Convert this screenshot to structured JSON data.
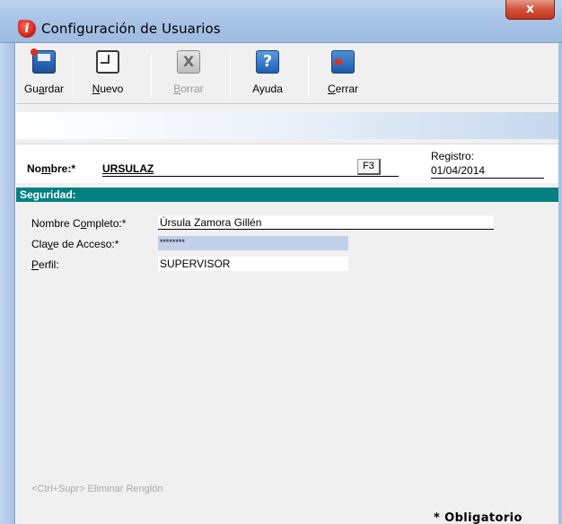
{
  "window": {
    "title": "Configuración de Usuarios",
    "close_glyph": "x",
    "app_icon": "app-i-icon"
  },
  "toolbar": {
    "buttons": [
      {
        "label_pre": "Gu",
        "label_u": "a",
        "label_post": "rdar",
        "icon": "save-icon",
        "enabled": true
      },
      {
        "label_pre": "",
        "label_u": "N",
        "label_post": "uevo",
        "icon": "new-document-icon",
        "enabled": true
      },
      {
        "label_pre": "",
        "label_u": "B",
        "label_post": "orrar",
        "icon": "delete-icon",
        "enabled": false
      },
      {
        "label_pre": "Ayuda",
        "label_u": "",
        "label_post": "",
        "icon": "help-icon",
        "enabled": true
      },
      {
        "label_pre": "",
        "label_u": "C",
        "label_post": "errar",
        "icon": "exit-icon",
        "enabled": true
      }
    ],
    "icon_glyphs": {
      "delete": "X",
      "help": "?"
    }
  },
  "header": {
    "nombre_label_pre": "No",
    "nombre_label_u": "m",
    "nombre_label_post": "bre:*",
    "nombre_value": "URSULAZ",
    "f3_label": "F3",
    "registro_label": "Registro:",
    "registro_value": "01/04/2014"
  },
  "section": {
    "title": "Seguridad:"
  },
  "form": {
    "nombre_completo_label_pre": "Nombre C",
    "nombre_completo_label_u": "o",
    "nombre_completo_label_post": "mpleto:*",
    "nombre_completo_value": "Úrsula Zamora Gillén",
    "clave_label_pre": "Cla",
    "clave_label_u": "v",
    "clave_label_post": "e de Acceso:*",
    "clave_value": "********",
    "perfil_label_pre": "",
    "perfil_label_u": "P",
    "perfil_label_post": "erfil:",
    "perfil_value": "SUPERVISOR"
  },
  "footer": {
    "hint": "<Ctrl+Supr> Eliminar Renglón",
    "obligatorio": "* Obligatorio"
  },
  "colors": {
    "section_bar": "#008080",
    "password_field": "#c3d0ea",
    "close_button": "#c2331a"
  }
}
